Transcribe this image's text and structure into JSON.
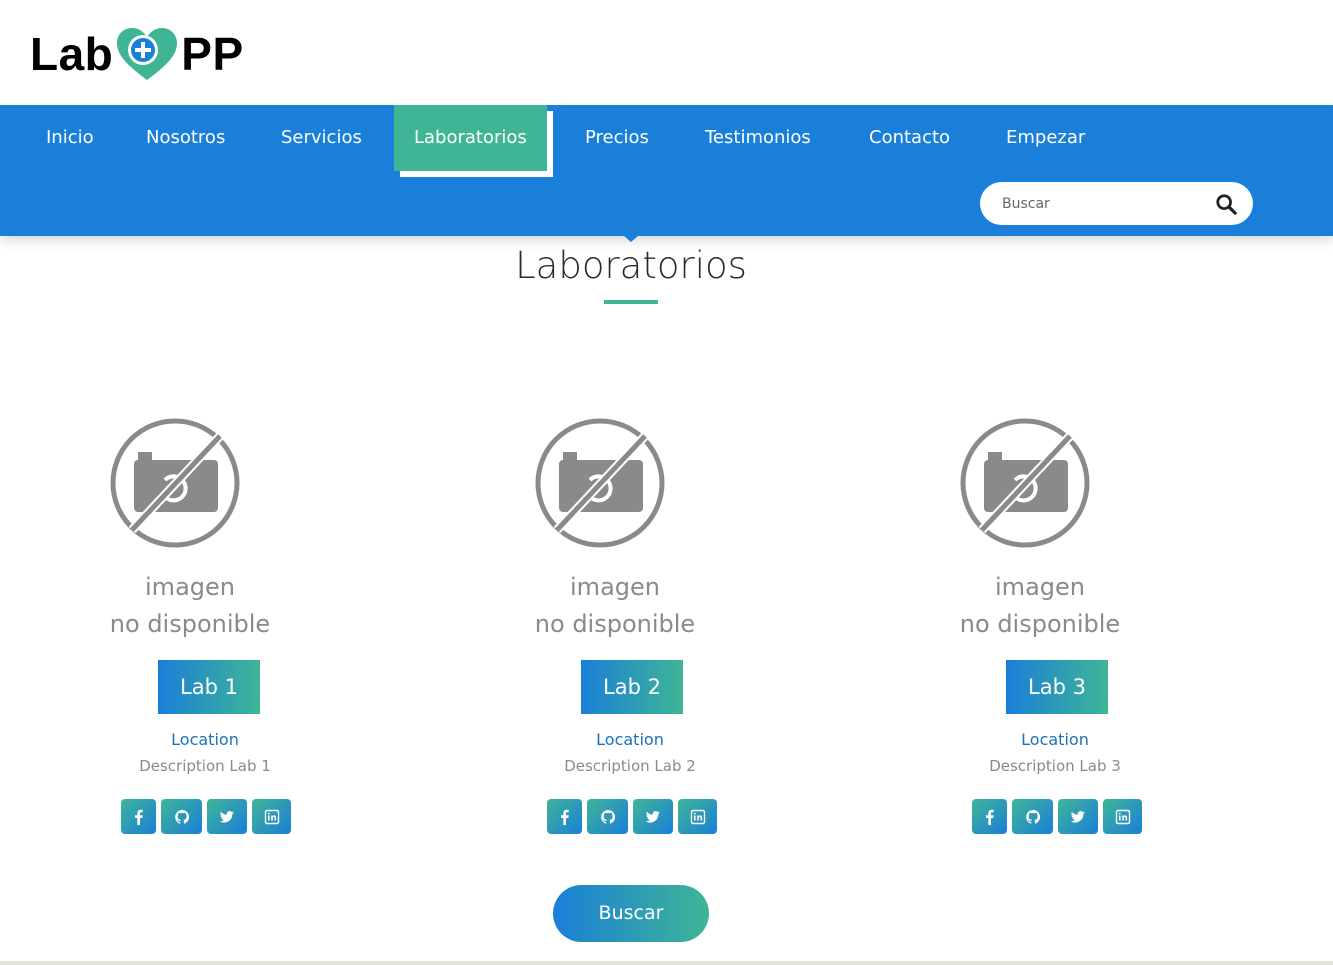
{
  "brand": {
    "left": "Lab",
    "right": "PP",
    "heart_color": "#3fb596",
    "plus_color": "#1a7fd8"
  },
  "nav": {
    "items": [
      {
        "label": "Inicio"
      },
      {
        "label": "Nosotros"
      },
      {
        "label": "Servicios"
      },
      {
        "label": "Laboratorios",
        "active": true
      },
      {
        "label": "Precios"
      },
      {
        "label": "Testimonios"
      },
      {
        "label": "Contacto"
      },
      {
        "label": "Empezar"
      }
    ],
    "bg_color": "#1a7fd8",
    "active_color": "#3fb596"
  },
  "search": {
    "placeholder": "Buscar",
    "icon": "search-icon"
  },
  "section": {
    "title": "Laboratorios"
  },
  "labs": [
    {
      "image_line1": "imagen",
      "image_line2": "no disponible",
      "name": "Lab 1",
      "location": "Location",
      "description": "Description Lab 1"
    },
    {
      "image_line1": "imagen",
      "image_line2": "no disponible",
      "name": "Lab 2",
      "location": "Location",
      "description": "Description Lab 2"
    },
    {
      "image_line1": "imagen",
      "image_line2": "no disponible",
      "name": "Lab 3",
      "location": "Location",
      "description": "Description Lab 3"
    }
  ],
  "social_icons": [
    "facebook-icon",
    "github-icon",
    "twitter-icon",
    "linkedin-icon"
  ],
  "search_button": {
    "label": "Buscar"
  }
}
